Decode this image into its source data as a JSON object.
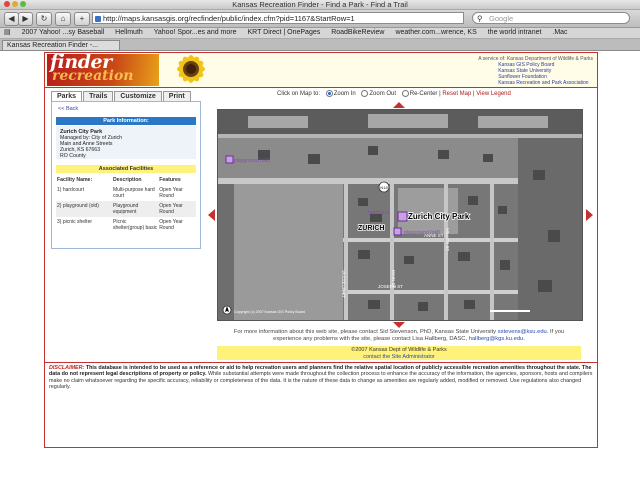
{
  "browser": {
    "window_title": "Kansas Recreation Finder - Find a Park - Find a Trail",
    "url": "http://maps.kansasgis.org/recfinder/public/index.cfm?pid=1167&StartRow=1",
    "search_placeholder": "Google",
    "tab_title": "Kansas Recreation Finder -...",
    "bookmarks": [
      "2007 Yahoo! ...sy Baseball",
      "Hellmuth",
      "Yahoo! Spor...es and more",
      "KRT Direct | OnePages",
      "RoadBikeReview",
      "weather.com...wrence, KS",
      "the world intranet",
      ".Mac"
    ]
  },
  "header": {
    "logo_word1": "finder",
    "logo_word2": "recreation",
    "agencies_lead": "A service of:",
    "agencies": [
      "Kansas Department of Wildlife & Parks",
      "Kansas GIS Policy Board",
      "Kansas State University",
      "Sunflower Foundation",
      "Kansas Recreation and Park Association"
    ]
  },
  "tabs": [
    "Parks",
    "Trails",
    "Customize",
    "Print"
  ],
  "left_panel": {
    "back_link": "<< Back",
    "park_info_header": "Park Information:",
    "park_name": "Zurich City Park",
    "managed_by": "Managed by: City of Zurich",
    "address": "Main and Anne Streets",
    "city": "Zurich, KS 67663",
    "county": "RO County",
    "facilities_header": "Associated Facilities",
    "columns": [
      "Facility Name:",
      "Description",
      "Features"
    ],
    "facilities": [
      {
        "name": "1) hardcourt",
        "desc": "Multi-purpose hard court",
        "feat": "Open Year Round"
      },
      {
        "name": "2) playground (old)",
        "desc": "Playground equipment",
        "feat": "Open Year Round"
      },
      {
        "name": "3) picnic shelter",
        "desc": "Picnic shelter(group) basic",
        "feat": "Open Year Round"
      }
    ]
  },
  "map_tools": {
    "prefix": "Click on Map to:",
    "zoom_in": "Zoom In",
    "zoom_out": "Zoom Out",
    "recenter": "Re-Center",
    "reset": "Reset Map",
    "legend": "View Legend",
    "separator": "|"
  },
  "map": {
    "park_label": "Zurich City Park",
    "town_label": "ZURICH",
    "route_marker": "N18",
    "streets": [
      "ANNE ST",
      "JOSEPH ST",
      "VASSEUR ST",
      "MAIN ST",
      "MILLER ST"
    ],
    "poi_labels": [
      "playground (old)",
      "hardcourt",
      "playground (old)"
    ],
    "copyright": "Copyright (c) 2007 Kansas GIS Policy Board"
  },
  "info_text": {
    "line1": "For more information about this web site, please contact Sid Stevenson, PhD, Kansas State University",
    "email1": "sstevens@ksu.edu",
    "line1_end": ". If you",
    "line2": "experience any problems with the site, please contact Lisa Hallberg, DASC,",
    "email2": "hallberg@kgs.ku.edu",
    "line2_end": "."
  },
  "copyright_bar": {
    "line1": "©2007 Kansas Dept of Wildlife & Parks",
    "line2": "contact the Site Administrator"
  },
  "disclaimer": {
    "label": "DISCLAIMER:",
    "bold_text": "This database is intended to be used as a reference or aid to help recreation users and planners find the relative spatial location of publicly accessible recreation amenities throughout the state. The data do not represent legal descriptions of property or policy.",
    "text": "While substantial attempts were made throughout the collection process to enhance the accuracy of the information, the agencies, sponsors, hosts and compilers make no claim whatsoever regarding the specific accuracy, reliability or completeness of the data. It is the nature of these data to change as amenities are regularly added, modified or removed. Use regulations also changed regularly."
  }
}
